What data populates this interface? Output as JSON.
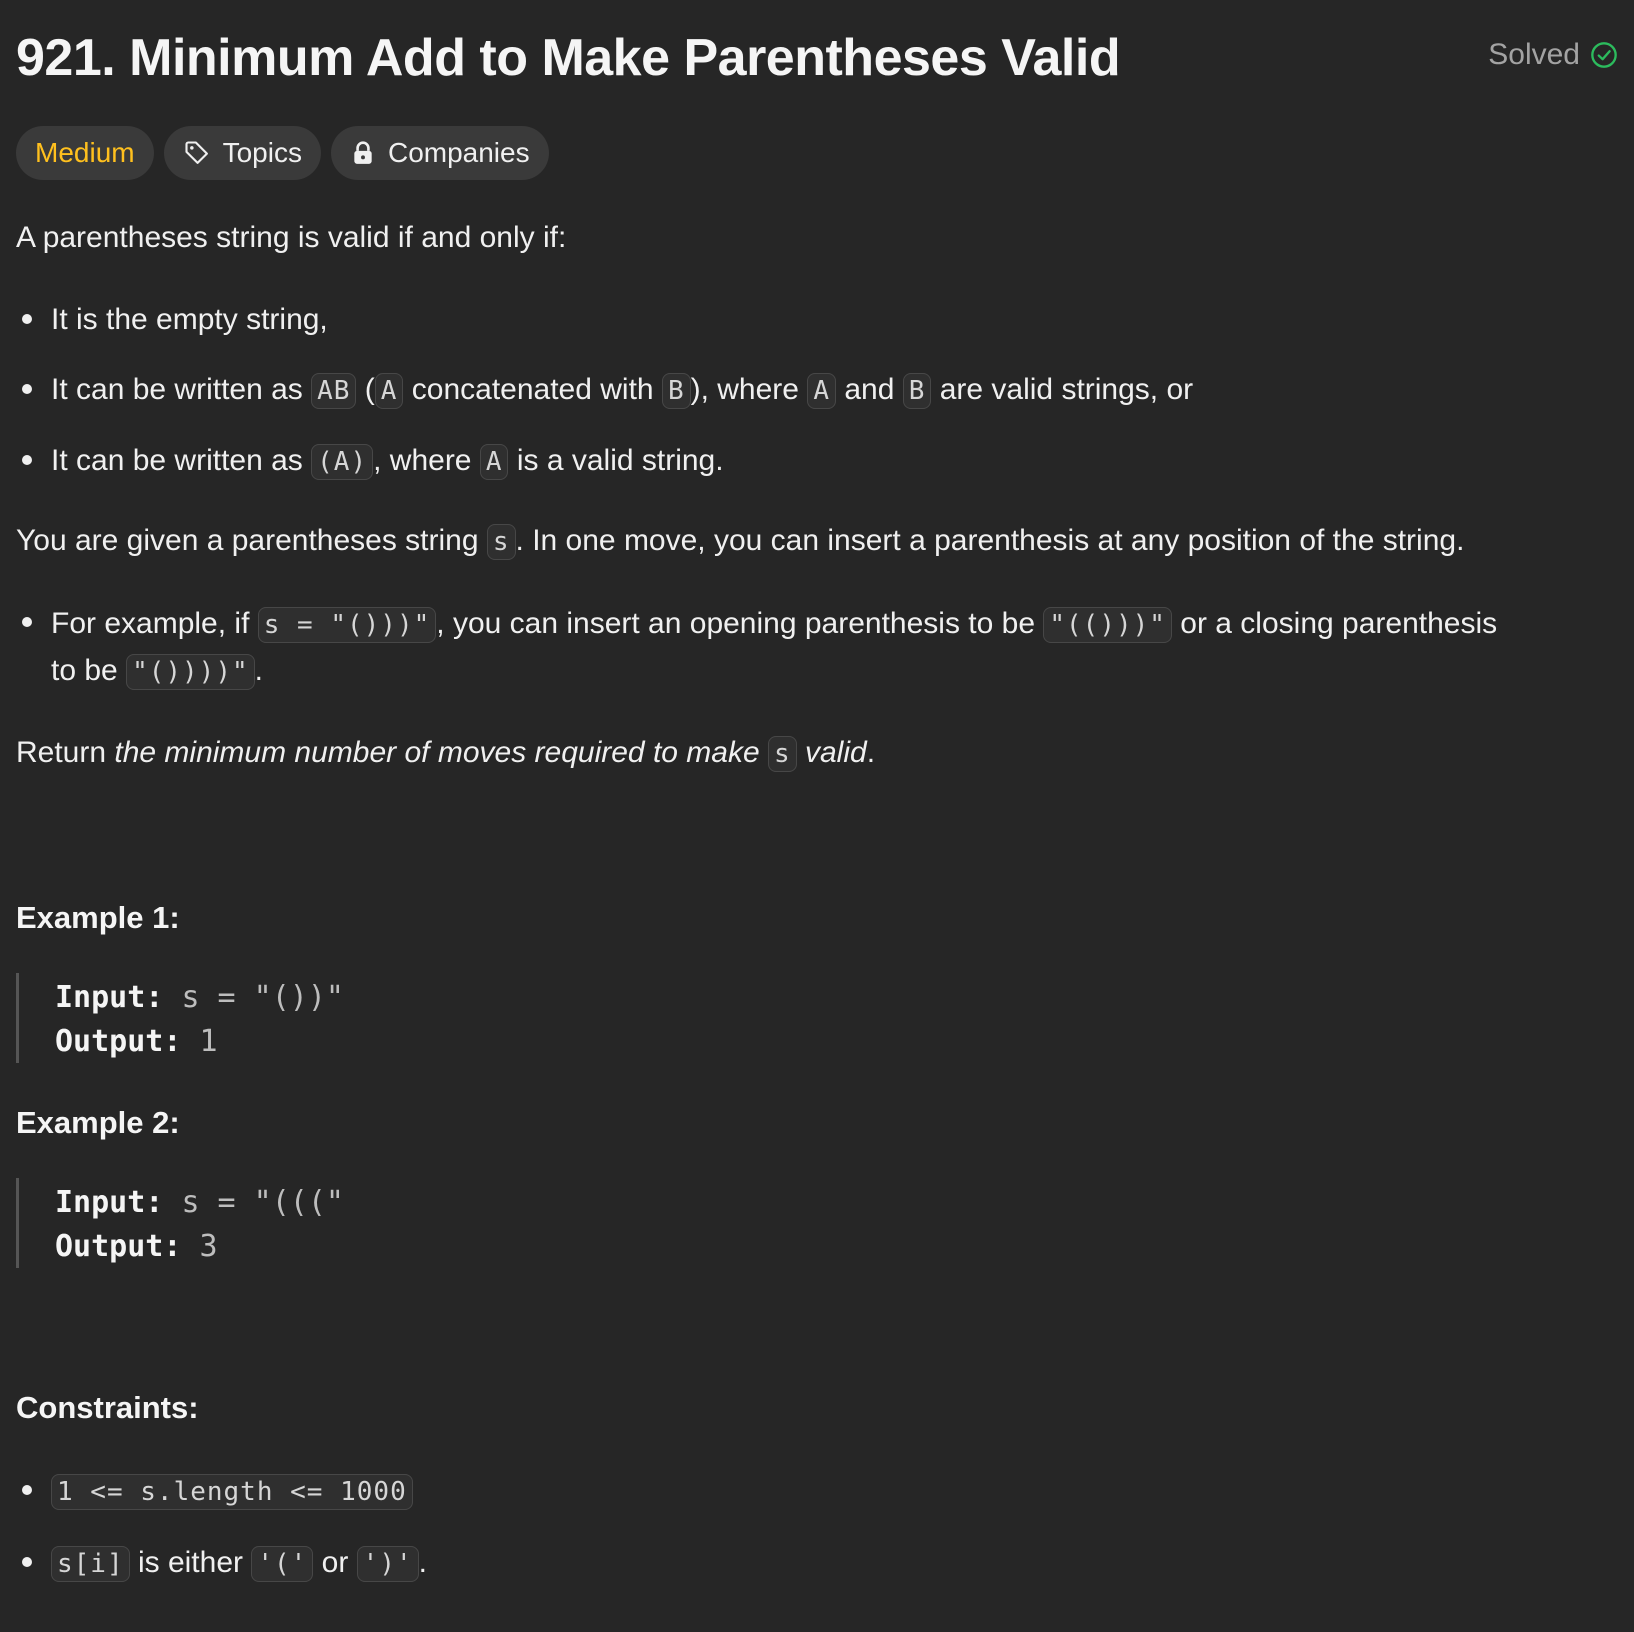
{
  "problem": {
    "title": "921. Minimum Add to Make Parentheses Valid",
    "status": "Solved",
    "status_color": "#2cbb5d"
  },
  "tags": {
    "difficulty": "Medium",
    "difficulty_color": "#ffc01e",
    "topics": "Topics",
    "companies": "Companies"
  },
  "description": {
    "intro": "A parentheses string is valid if and only if:",
    "rules": [
      {
        "text": "It is the empty string,"
      },
      {
        "p1": "It can be written as ",
        "c1": "AB",
        "p2": " (",
        "c2": "A",
        "p3": " concatenated with ",
        "c3": "B",
        "p4": "), where ",
        "c4": "A",
        "p5": " and ",
        "c5": "B",
        "p6": " are valid strings, or"
      },
      {
        "p1": "It can be written as ",
        "c1": "(A)",
        "p2": ", where ",
        "c2": "A",
        "p3": " is a valid string."
      }
    ],
    "given": {
      "p1": "You are given a parentheses string ",
      "c1": "s",
      "p2": ". In one move, you can insert a parenthesis at any position of the string."
    },
    "example_note": {
      "p1": "For example, if ",
      "c1": "s = \"()))\"",
      "p2": ", you can insert an opening parenthesis to be ",
      "c2": "\"(()))\"",
      "p3": " or a closing parenthesis",
      "p4": "to be ",
      "c3": "\"())))\"",
      "p5": "."
    },
    "return": {
      "p1": "Return ",
      "em1": "the minimum number of moves required to make ",
      "c1": "s",
      "em2": " valid",
      "p2": "."
    }
  },
  "examples": [
    {
      "heading": "Example 1:",
      "input_label": "Input:",
      "input_value": "s = \"())\"",
      "output_label": "Output:",
      "output_value": "1"
    },
    {
      "heading": "Example 2:",
      "input_label": "Input:",
      "input_value": "s = \"(((\"",
      "output_label": "Output:",
      "output_value": "3"
    }
  ],
  "constraints": {
    "heading": "Constraints:",
    "items": [
      {
        "c1": "1 <= s.length <= 1000"
      },
      {
        "c1": "s[i]",
        "p1": " is either ",
        "c2": "'('",
        "p2": " or ",
        "c3": "')'",
        "p3": "."
      }
    ]
  }
}
